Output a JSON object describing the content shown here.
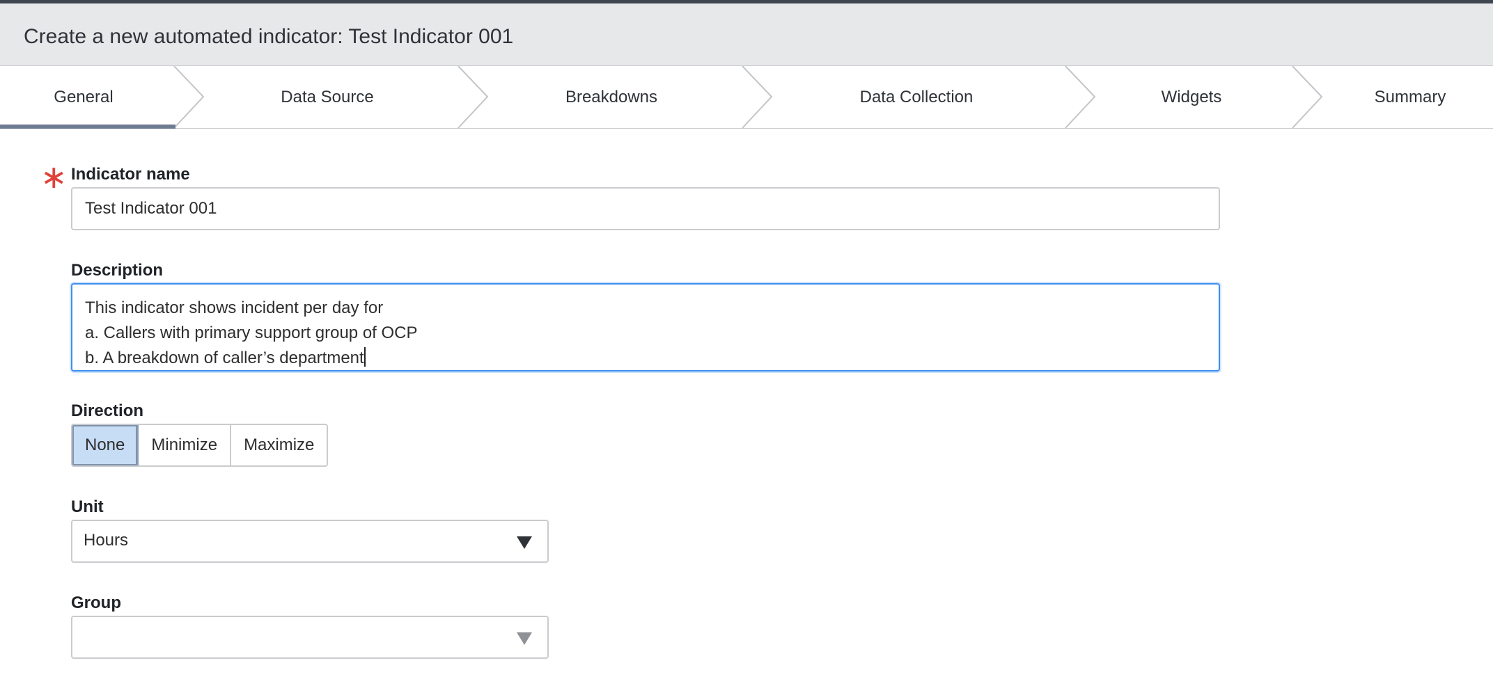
{
  "header": {
    "title": "Create a new automated indicator: Test Indicator 001"
  },
  "wizard": {
    "steps": [
      {
        "label": "General",
        "active": true
      },
      {
        "label": "Data Source",
        "active": false
      },
      {
        "label": "Breakdowns",
        "active": false
      },
      {
        "label": "Data Collection",
        "active": false
      },
      {
        "label": "Widgets",
        "active": false
      },
      {
        "label": "Summary",
        "active": false
      }
    ]
  },
  "form": {
    "indicator_name": {
      "label": "Indicator name",
      "required_mark": "∗",
      "value": "Test Indicator 001"
    },
    "description": {
      "label": "Description",
      "lines": [
        "This indicator shows incident per day for",
        "a. Callers with primary support group of OCP",
        "b. A breakdown of caller’s department"
      ]
    },
    "direction": {
      "label": "Direction",
      "options": [
        "None",
        "Minimize",
        "Maximize"
      ],
      "selected": "None"
    },
    "unit": {
      "label": "Unit",
      "value": "Hours"
    },
    "group": {
      "label": "Group",
      "value": ""
    }
  },
  "colors": {
    "accent": "#3d8ff0",
    "required": "#e0433b",
    "selected_segment": "#c7dcf5",
    "active_step_bar": "#6e7c92",
    "header_bg": "#e6e8ea"
  }
}
